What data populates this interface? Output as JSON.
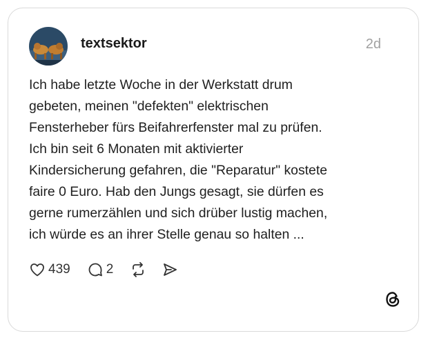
{
  "post": {
    "username": "textsektor",
    "time": "2d",
    "text": "Ich habe letzte Woche in der Werkstatt drum\ngebeten, meinen \"defekten\" elektrischen\nFensterheber fürs Beifahrerfenster mal zu prüfen.\nIch bin seit 6 Monaten mit aktivierter\nKindersicherung gefahren, die \"Reparatur\" kostete\nfaire 0 Euro. Hab den Jungs gesagt, sie dürfen es\ngerne rumerzählen und sich drüber lustig machen,\nich würde es an ihrer Stelle genau so halten ...",
    "likes": "439",
    "replies": "2"
  },
  "icons": {
    "like": "heart-icon",
    "reply": "comment-icon",
    "repost": "repost-icon",
    "share": "send-icon",
    "brand": "threads-logo"
  },
  "colors": {
    "border": "#d9d9d9",
    "muted": "#a0a0a0",
    "text": "#1f1f1f"
  }
}
